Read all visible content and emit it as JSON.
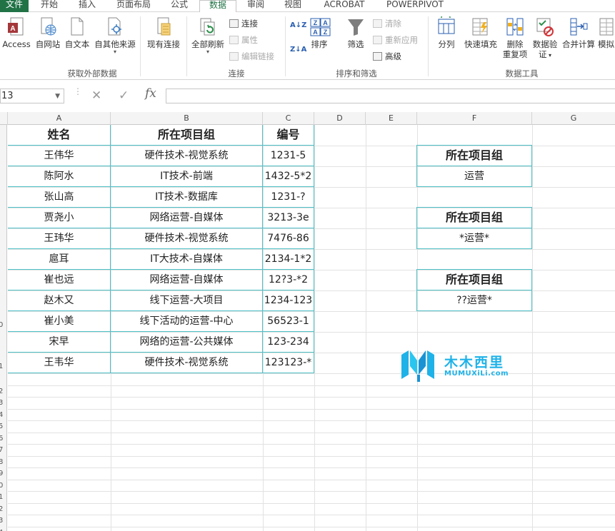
{
  "tabs": [
    "文件",
    "开始",
    "插入",
    "页面布局",
    "公式",
    "数据",
    "审阅",
    "视图",
    "ACROBAT",
    "POWERPIVOT"
  ],
  "active_tab": "数据",
  "ribbon": {
    "get_external": {
      "access": "Access",
      "web": "自网站",
      "text": "自文本",
      "other": "自其他来源",
      "existing": "现有连接",
      "label": "获取外部数据"
    },
    "connections": {
      "refresh_all": "全部刷新",
      "connections": "连接",
      "properties": "属性",
      "edit_links": "编辑链接",
      "label": "连接"
    },
    "sort_filter": {
      "sort": "排序",
      "filter": "筛选",
      "clear": "清除",
      "reapply": "重新应用",
      "advanced": "高级",
      "label": "排序和筛选"
    },
    "data_tools": {
      "text_to_cols": "分列",
      "flash_fill": "快速填充",
      "remove_dup_1": "删除",
      "remove_dup_2": "重复项",
      "validation_1": "数据验",
      "validation_2": "证",
      "consolidate": "合并计算",
      "what_if": "模拟",
      "label": "数据工具"
    }
  },
  "formula_bar": {
    "name_box": "13",
    "fx": "fx",
    "content": ""
  },
  "columns": [
    "A",
    "B",
    "C",
    "D",
    "E",
    "F",
    "G"
  ],
  "row_numbers": [
    "",
    "",
    "",
    "",
    "",
    "",
    "",
    "",
    "",
    "0",
    "",
    "1",
    "",
    "2",
    "3",
    "4",
    "5",
    "6",
    "7",
    "8",
    "9",
    "0",
    "1",
    "2",
    "3",
    "4"
  ],
  "table": {
    "headers": [
      "姓名",
      "所在项目组",
      "编号"
    ],
    "rows": [
      [
        "王伟华",
        "硬件技术-视觉系统",
        "1231-5"
      ],
      [
        "陈阿水",
        "IT技术-前端",
        "1432-5*2"
      ],
      [
        "张山高",
        "IT技术-数据库",
        "1231-?"
      ],
      [
        "贾尧小",
        "网络运营-自媒体",
        "3213-3e"
      ],
      [
        "王玮华",
        "硬件技术-视觉系统",
        "7476-86"
      ],
      [
        "扈耳",
        "IT大技术-自媒体",
        "2134-1*2"
      ],
      [
        "崔也远",
        "网络运营-自媒体",
        "12?3-*2"
      ],
      [
        "赵木又",
        "线下运营-大项目",
        "1234-123"
      ],
      [
        "崔小美",
        "线下活动的运营-中心",
        "56523-1"
      ],
      [
        "宋早",
        "网络的运营-公共媒体",
        "123-234"
      ],
      [
        "王韦华",
        "硬件技术-视觉系统",
        "123123-*"
      ]
    ]
  },
  "criteria": [
    {
      "header": "所在项目组",
      "value": "运营"
    },
    {
      "header": "所在项目组",
      "value": "*运营*"
    },
    {
      "header": "所在项目组",
      "value": "??运营*"
    }
  ],
  "watermark": {
    "name": "木木西里",
    "url": "MUMUXiLi.com"
  }
}
